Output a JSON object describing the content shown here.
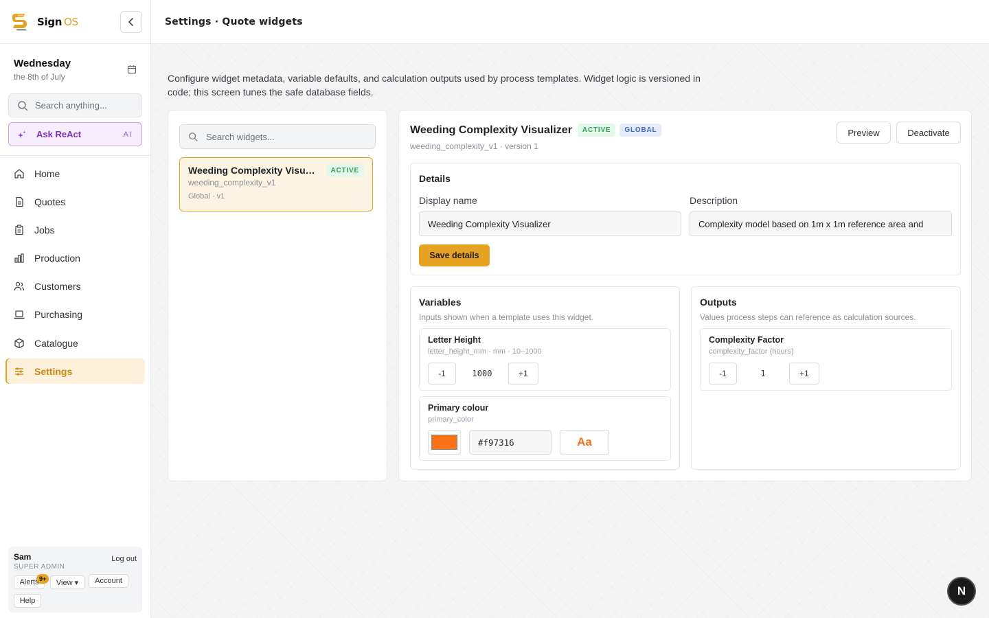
{
  "app": {
    "brand_main": "Sign",
    "brand_accent": "OS",
    "accent_color": "#e6a321"
  },
  "date": {
    "day": "Wednesday",
    "sub": "the 8th of July"
  },
  "sidebar": {
    "search_placeholder": "Search anything...",
    "ask_label": "Ask ReAct",
    "ask_badge": "AI",
    "items": [
      {
        "label": "Home",
        "icon": "home-icon"
      },
      {
        "label": "Quotes",
        "icon": "document-icon"
      },
      {
        "label": "Jobs",
        "icon": "clipboard-icon"
      },
      {
        "label": "Production",
        "icon": "bar-chart-icon"
      },
      {
        "label": "Customers",
        "icon": "users-icon"
      },
      {
        "label": "Purchasing",
        "icon": "laptop-icon"
      },
      {
        "label": "Catalogue",
        "icon": "box-icon"
      },
      {
        "label": "Settings",
        "icon": "sliders-icon",
        "active": true
      }
    ]
  },
  "user": {
    "name": "Sam",
    "role": "SUPER ADMIN",
    "logout": "Log out",
    "alerts": "Alerts",
    "alerts_badge": "9+",
    "view": "View ▾",
    "account": "Account",
    "help": "Help"
  },
  "header": {
    "breadcrumb": "Settings · Quote widgets"
  },
  "intro": "Configure widget metadata, variable defaults, and calculation outputs used by process templates. Widget logic is versioned in code; this screen tunes the safe database fields.",
  "widget_list": {
    "search_placeholder": "Search widgets...",
    "items": [
      {
        "title": "Weeding Complexity Visualizer",
        "key": "weeding_complexity_v1",
        "meta": "Global · v1",
        "status": "ACTIVE"
      }
    ]
  },
  "detail": {
    "title": "Weeding Complexity Visualizer",
    "status": "ACTIVE",
    "scope": "GLOBAL",
    "subtitle": "weeding_complexity_v1 · version 1",
    "preview_label": "Preview",
    "deactivate_label": "Deactivate",
    "details": {
      "heading": "Details",
      "display_name_label": "Display name",
      "display_name_value": "Weeding Complexity Visualizer",
      "description_label": "Description",
      "description_value": "Complexity model based on 1m x 1m reference area and",
      "save_label": "Save details"
    },
    "variables": {
      "heading": "Variables",
      "subheading": "Inputs shown when a template uses this widget.",
      "letter_height": {
        "title": "Letter Height",
        "meta": "letter_height_mm · mm · 10–1000",
        "minus": "-1",
        "value": "1000",
        "plus": "+1"
      },
      "primary_colour": {
        "title": "Primary colour",
        "key": "primary_color",
        "hex": "#f97316",
        "preview_text": "Aa",
        "color": "#f97316"
      }
    },
    "outputs": {
      "heading": "Outputs",
      "subheading": "Values process steps can reference as calculation sources.",
      "complexity": {
        "title": "Complexity Factor",
        "meta": "complexity_factor (hours)",
        "minus": "-1",
        "value": "1",
        "plus": "+1"
      }
    }
  },
  "fab_label": "N"
}
